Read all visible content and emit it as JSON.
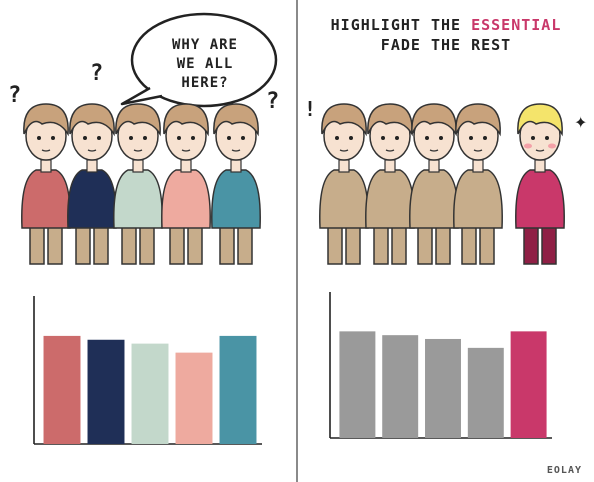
{
  "left": {
    "bubble_lines": [
      "WHY ARE",
      "WE ALL",
      "HERE?"
    ]
  },
  "right": {
    "heading_line1_prefix": "HIGHLIGHT THE",
    "heading_line1_accent": "ESSENTIAL",
    "heading_line2": "FADE THE REST"
  },
  "signature": "EOLAY",
  "colors": {
    "red": "#cc6b6b",
    "navy": "#1f2f57",
    "mint": "#c3d8cb",
    "pink": "#eeaa9f",
    "teal": "#4a94a5",
    "gray": "#9a9a9a",
    "magenta": "#c9386a",
    "skin": "#f7e2d1",
    "hair": "#c8a27c",
    "blond": "#f4e46b",
    "pants": "#c7ad8b"
  },
  "chart_data": [
    {
      "type": "bar",
      "categories": [
        "",
        "",
        "",
        "",
        ""
      ],
      "values": [
        8.4,
        8.1,
        7.8,
        7.1,
        8.4
      ],
      "colors": [
        "#cc6b6b",
        "#1f2f57",
        "#c3d8cb",
        "#eeaa9f",
        "#4a94a5"
      ],
      "ylim": [
        0,
        11.5
      ],
      "grid": false
    },
    {
      "type": "bar",
      "categories": [
        "",
        "",
        "",
        "",
        ""
      ],
      "values": [
        8.4,
        8.1,
        7.8,
        7.1,
        8.4
      ],
      "colors": [
        "#9a9a9a",
        "#9a9a9a",
        "#9a9a9a",
        "#9a9a9a",
        "#c9386a"
      ],
      "ylim": [
        0,
        11.5
      ],
      "grid": false
    }
  ]
}
